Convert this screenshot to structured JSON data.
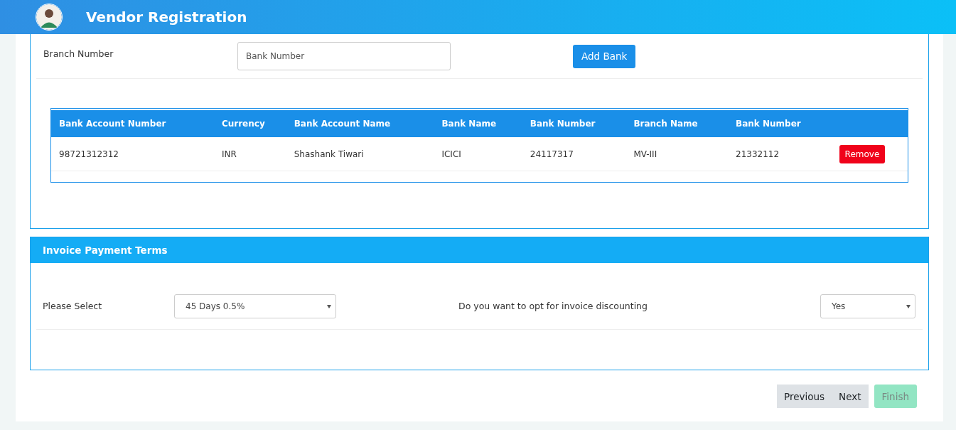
{
  "header": {
    "title": "Vendor Registration"
  },
  "bank_section": {
    "branch_label": "Branch Number",
    "bank_number_field": {
      "placeholder": "Bank Number"
    },
    "add_button": "Add Bank",
    "table": {
      "columns": [
        "Bank Account Number",
        "Currency",
        "Bank Account Name",
        "Bank Name",
        "Bank Number",
        "Branch Name",
        "Bank Number"
      ],
      "rows": [
        {
          "cells": [
            "98721312312",
            "INR",
            "Shashank Tiwari",
            "ICICI",
            "24117317",
            "MV-III",
            "21332112"
          ],
          "action": "Remove"
        }
      ]
    }
  },
  "payment_terms": {
    "title": "Invoice Payment Terms",
    "select_label": "Please Select",
    "select_value": "45 Days 0.5%",
    "discount_label": "Do you want to opt for invoice discounting",
    "discount_value": "Yes"
  },
  "footer": {
    "buttons": [
      {
        "label": "Previous",
        "disabled": false
      },
      {
        "label": "Next",
        "disabled": false
      }
    ],
    "finish": {
      "label": "Finish",
      "disabled": true
    }
  }
}
